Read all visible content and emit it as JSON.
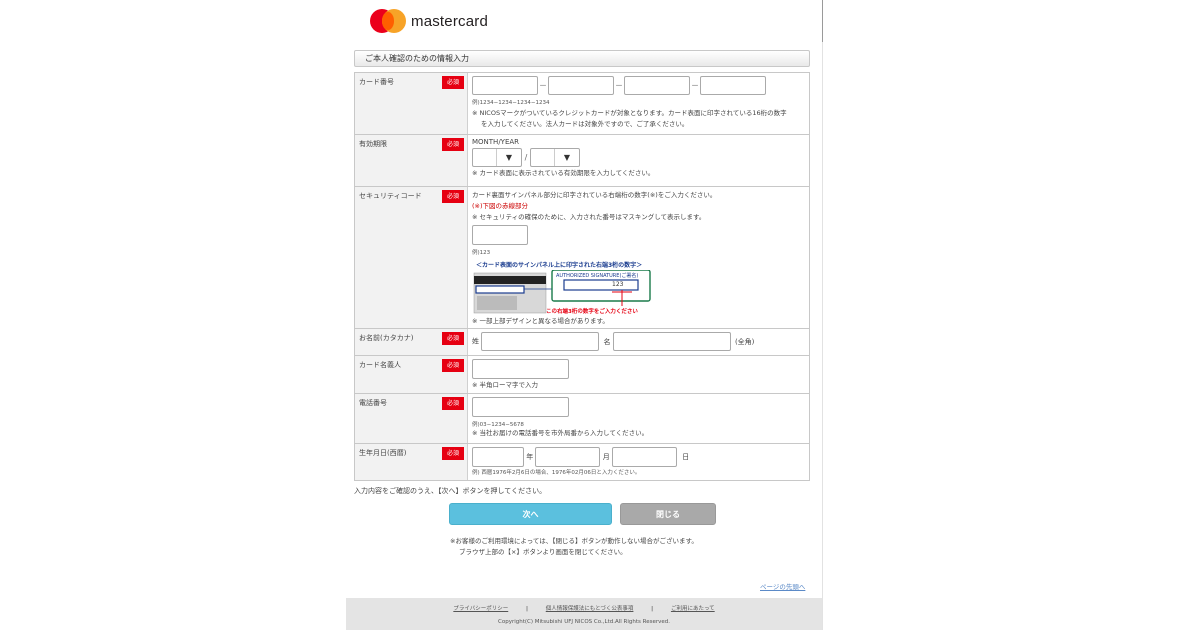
{
  "brand": {
    "name": "mastercard",
    "colors": {
      "red": "#eb001b",
      "orange": "#f79e1b",
      "overlap": "#ff5f00"
    }
  },
  "section_title": "ご本人確認のための情報入力",
  "required_badge": "必須",
  "fields": {
    "card_number": {
      "label": "カード番号",
      "separator": "－",
      "example": "例)1234−1234−1234−1234",
      "note1": "※ NICOSマークがついているクレジットカードが対象となります。カード表面に印字されている16桁の数字",
      "note2": "を入力してください。法人カードは対象外ですので、ご了承ください。"
    },
    "expiry": {
      "label": "有効期限",
      "format": "MONTH/YEAR",
      "separator": "/",
      "note": "※ カード表面に表示されている有効期限を入力してください。"
    },
    "security_code": {
      "label": "セキュリティコード",
      "line1": "カード裏面サインパネル部分に印字されている右端桁の数字(※)をご入力ください。",
      "line2": "(※)下図の赤線部分",
      "line3": "※ セキュリティの確保のために、入力された番号はマスキングして表示します。",
      "example": "例)123",
      "illus_title": "＜カード表面のサインパネル上に印字された右端3桁の数字＞",
      "illus_panel": "AUTHORIZED SIGNATURE(ご署名)",
      "illus_digits": "123",
      "illus_caption": "この右端3桁の数字をご入力ください",
      "note": "※ 一部上部デザインと異なる場合があります。"
    },
    "name_kana": {
      "label": "お名前(カタカナ)",
      "sei": "姓",
      "mei": "名",
      "suffix": "(全角)"
    },
    "card_holder": {
      "label": "カード名義人",
      "note": "※ 半角ローマ字で入力"
    },
    "phone": {
      "label": "電話番号",
      "example": "例)03−1234−5678",
      "note": "※ 当社お届けの電話番号を市外局番から入力してください。"
    },
    "birthdate": {
      "label": "生年月日(西暦)",
      "year": "年",
      "month": "月",
      "day": "日",
      "example": "例) 西暦1976年2月6日の場合、1976年02月06日と入力ください。"
    }
  },
  "confirm_text": "入力内容をご確認のうえ、【次へ】ボタンを押してください。",
  "buttons": {
    "next": "次へ",
    "close": "閉じる"
  },
  "footnote1": "※お客様のご利用環境によっては、【閉じる】ボタンが動作しない場合がございます。",
  "footnote2": "ブラウザ上部の【×】ボタンより画面を閉じてください。",
  "page_top": "ページの先頭へ",
  "footer": {
    "links": [
      "プライバシーポリシー",
      "個人情報保護法にもとづく公表事項",
      "ご利用にあたって"
    ],
    "separator": "|",
    "copyright": "Copyright(C) Mitsubishi UFJ NICOS Co.,Ltd.All Rights Reserved."
  }
}
